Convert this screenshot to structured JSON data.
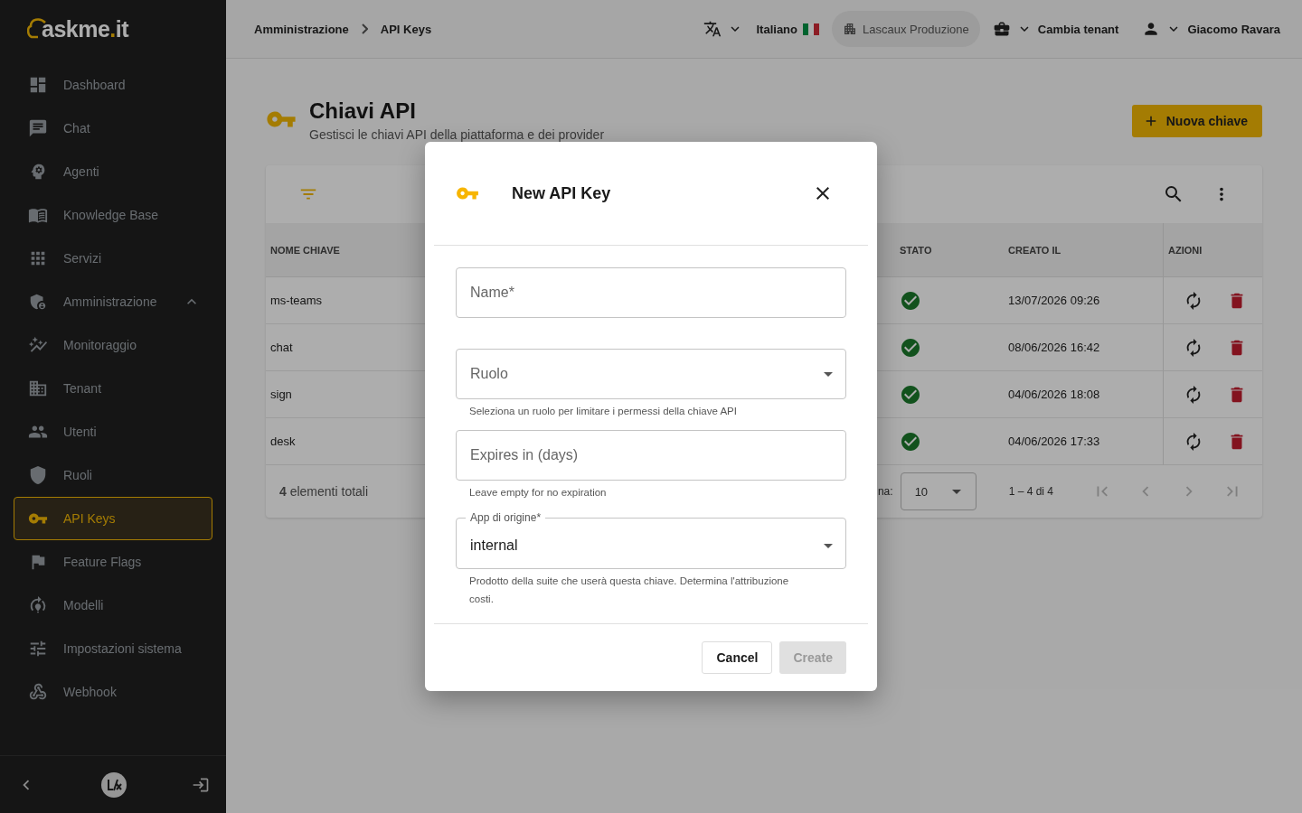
{
  "sidebar": {
    "logo": {
      "name": "askme",
      "dot": ".",
      "suffix": "it"
    },
    "items": [
      {
        "label": "Dashboard",
        "selected": false
      },
      {
        "label": "Chat",
        "selected": false
      },
      {
        "label": "Agenti",
        "selected": false
      },
      {
        "label": "Knowledge Base",
        "selected": false
      },
      {
        "label": "Servizi",
        "selected": false
      },
      {
        "label": "Amministrazione",
        "selected": false,
        "expanded": true
      },
      {
        "label": "Monitoraggio",
        "selected": false
      },
      {
        "label": "Tenant",
        "selected": false
      },
      {
        "label": "Utenti",
        "selected": false
      },
      {
        "label": "Ruoli",
        "selected": false
      },
      {
        "label": "API Keys",
        "selected": true
      },
      {
        "label": "Feature Flags",
        "selected": false
      },
      {
        "label": "Modelli",
        "selected": false
      },
      {
        "label": "Impostazioni sistema",
        "selected": false
      },
      {
        "label": "Webhook",
        "selected": false
      }
    ]
  },
  "topbar": {
    "breadcrumb": [
      "Amministrazione",
      "API Keys"
    ],
    "language": "Italiano",
    "tenant": "Lascaux Produzione",
    "switch_tenant": "Cambia tenant",
    "user": "Giacomo Ravara"
  },
  "page": {
    "title": "Chiavi API",
    "subtitle": "Gestisci le chiavi API della piattaforma e dei provider",
    "new_button": "Nuova chiave"
  },
  "table": {
    "columns": [
      "NOME CHIAVE",
      "STATO",
      "CREATO IL",
      "AZIONI"
    ],
    "rows": [
      {
        "name": "ms-teams",
        "active": true,
        "created": "13/07/2026 09:26"
      },
      {
        "name": "chat",
        "active": true,
        "created": "08/06/2026 16:42"
      },
      {
        "name": "sign",
        "active": true,
        "created": "04/06/2026 18:08"
      },
      {
        "name": "desk",
        "active": true,
        "created": "04/06/2026 17:33"
      }
    ],
    "total": "**4** elementi totali",
    "page_size_label": "na:",
    "page_size": "10",
    "range": "1 – 4 di 4",
    "pager_disabled": true
  },
  "dialog": {
    "title": "New API Key",
    "fields": [
      {
        "kind": "text",
        "placeholder": "Name*"
      },
      {
        "kind": "select",
        "placeholder": "Ruolo",
        "helper": "Seleziona un ruolo per limitare i permessi della chiave API"
      },
      {
        "kind": "text",
        "placeholder": "Expires in (days)",
        "helper": "Leave empty for no expiration"
      },
      {
        "kind": "select",
        "label": "App di origine*",
        "value": "internal",
        "helper": "Prodotto della suite che userà questa chiave. Determina l'attribuzione costi."
      }
    ],
    "cancel": "Cancel",
    "create": {
      "label": "Create",
      "disabled": true
    }
  }
}
